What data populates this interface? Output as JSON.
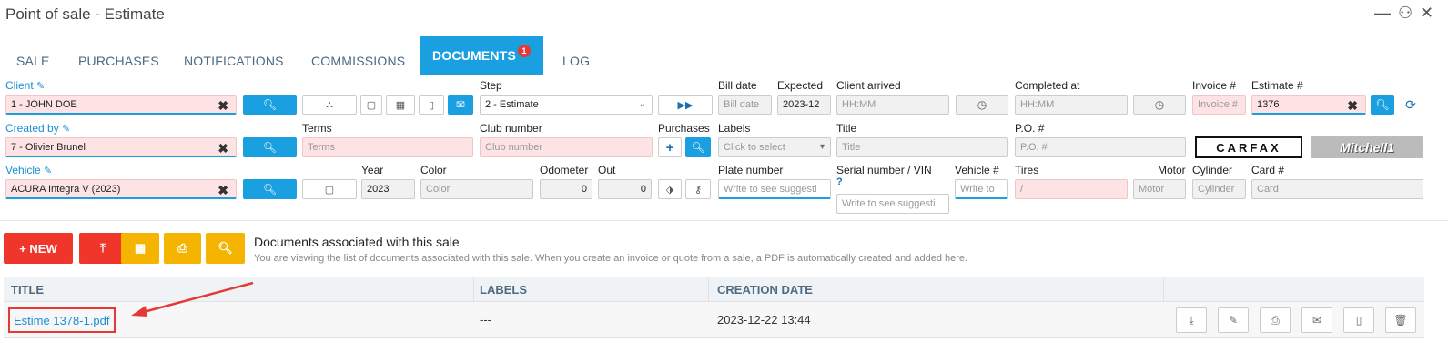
{
  "window": {
    "title": "Point of sale - Estimate",
    "controls": {
      "minimize": "—",
      "chat": "⚇",
      "close": "✕"
    }
  },
  "tabs": [
    {
      "label": "SALE"
    },
    {
      "label": "PURCHASES"
    },
    {
      "label": "NOTIFICATIONS"
    },
    {
      "label": "COMMISSIONS"
    },
    {
      "label": "DOCUMENTS",
      "badge": "1",
      "active": true
    },
    {
      "label": "LOG"
    }
  ],
  "form": {
    "client": {
      "label": "Client",
      "value": "1 - JOHN DOE"
    },
    "created_by": {
      "label": "Created by",
      "value": "7 - Olivier Brunel"
    },
    "vehicle": {
      "label": "Vehicle",
      "value": "ACURA Integra V (2023)"
    },
    "step": {
      "label": "Step",
      "value": "2 - Estimate"
    },
    "terms": {
      "label": "Terms",
      "placeholder": "Terms"
    },
    "club_number": {
      "label": "Club number",
      "placeholder": "Club number"
    },
    "purchases": {
      "label": "Purchases"
    },
    "year": {
      "label": "Year",
      "value": "2023"
    },
    "color": {
      "label": "Color",
      "placeholder": "Color"
    },
    "odometer": {
      "label": "Odometer",
      "value": "0"
    },
    "out": {
      "label": "Out",
      "value": "0"
    },
    "bill_date": {
      "label": "Bill date",
      "placeholder": "Bill date"
    },
    "expected": {
      "label": "Expected",
      "value": "2023-12"
    },
    "client_arrived": {
      "label": "Client arrived",
      "placeholder": "HH:MM"
    },
    "completed_at": {
      "label": "Completed at",
      "placeholder": "HH:MM"
    },
    "invoice": {
      "label": "Invoice #",
      "placeholder": "Invoice #"
    },
    "estimate": {
      "label": "Estimate #",
      "value": "1376"
    },
    "labels": {
      "label": "Labels",
      "placeholder": "Click to select"
    },
    "title": {
      "label": "Title",
      "placeholder": "Title"
    },
    "po": {
      "label": "P.O. #",
      "placeholder": "P.O. #"
    },
    "plate_number": {
      "label": "Plate number",
      "placeholder": "Write to see suggesti"
    },
    "serial_vin": {
      "label": "Serial number / VIN",
      "placeholder": "Write to see suggesti"
    },
    "vehicle_no": {
      "label": "Vehicle #",
      "placeholder": "Write to"
    },
    "tires": {
      "label": "Tires",
      "value": "/"
    },
    "motor": {
      "label": "Motor",
      "placeholder": "Motor"
    },
    "cylinder": {
      "label": "Cylinder",
      "placeholder": "Cylinder"
    },
    "card": {
      "label": "Card #",
      "placeholder": "Card"
    },
    "logos": {
      "carfax": "CARFAX",
      "mitchell": "Mitchell1"
    }
  },
  "actions": {
    "new_label": "+ NEW"
  },
  "documents": {
    "heading": "Documents associated with this sale",
    "subtext": "You are viewing the list of documents associated with this sale. When you create an invoice or quote from a sale, a PDF is automatically created and added here.",
    "columns": [
      "TITLE",
      "LABELS",
      "CREATION DATE"
    ],
    "rows": [
      {
        "title": "Estime 1378-1.pdf",
        "labels": "---",
        "created": "2023-12-22 13:44"
      }
    ]
  },
  "colors": {
    "accent": "#1a9fe0",
    "danger": "#f0352a",
    "warning": "#f5b400",
    "required": "#fde3e4"
  }
}
